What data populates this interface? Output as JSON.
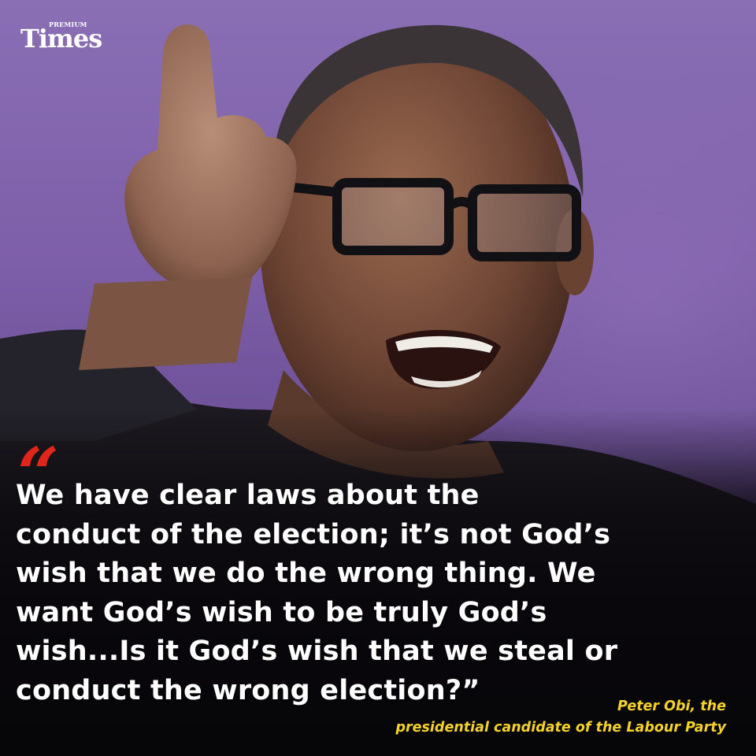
{
  "brand": {
    "premium": "PREMIUM",
    "name": "Times"
  },
  "quote": {
    "open_mark": "“",
    "lines": [
      "We have clear laws about the",
      "conduct of the election; it’s not God’s",
      "wish that we do the wrong thing. We",
      "want God’s wish to be truly God’s",
      "wish...Is it God’s wish that we steal or",
      "conduct the wrong election?”"
    ]
  },
  "attribution": {
    "lines": [
      "Peter Obi, the",
      "presidential candidate of the Labour Party"
    ]
  },
  "colors": {
    "background": "#7a5fa0",
    "quote_mark": "#e0251b",
    "quote_text": "#ffffff",
    "attribution": "#f5d22b"
  }
}
